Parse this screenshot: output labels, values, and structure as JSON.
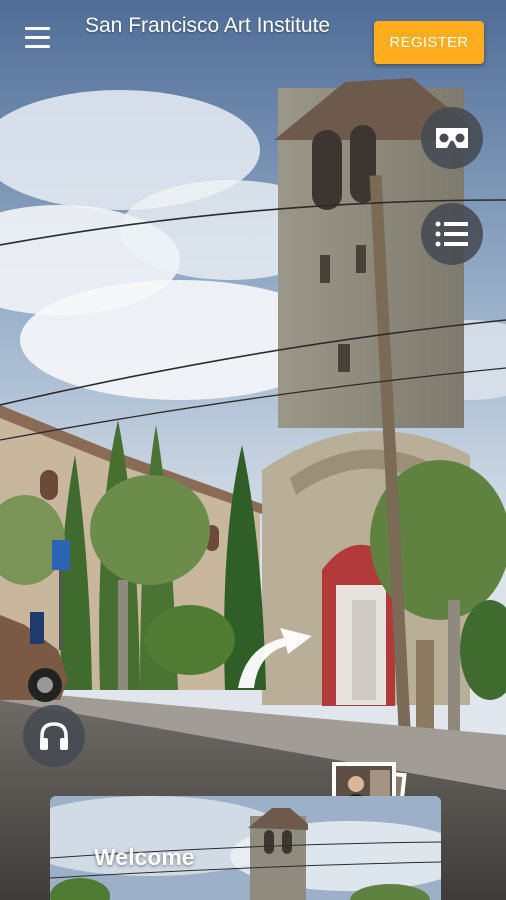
{
  "header": {
    "title": "San Francisco Art Institute",
    "register_label": "REGISTER"
  },
  "icons": {
    "menu": "hamburger-menu-icon",
    "vr": "vr-headset-icon",
    "list": "list-icon",
    "audio": "headphones-icon",
    "navigate": "curved-arrow-icon",
    "street_sign": "accessibility-sign"
  },
  "thumbnail": {
    "count": "2"
  },
  "card": {
    "title": "Welcome"
  },
  "colors": {
    "accent": "#ffad1f",
    "badge": "#2fb6ec",
    "overlay_button": "#464a52"
  }
}
